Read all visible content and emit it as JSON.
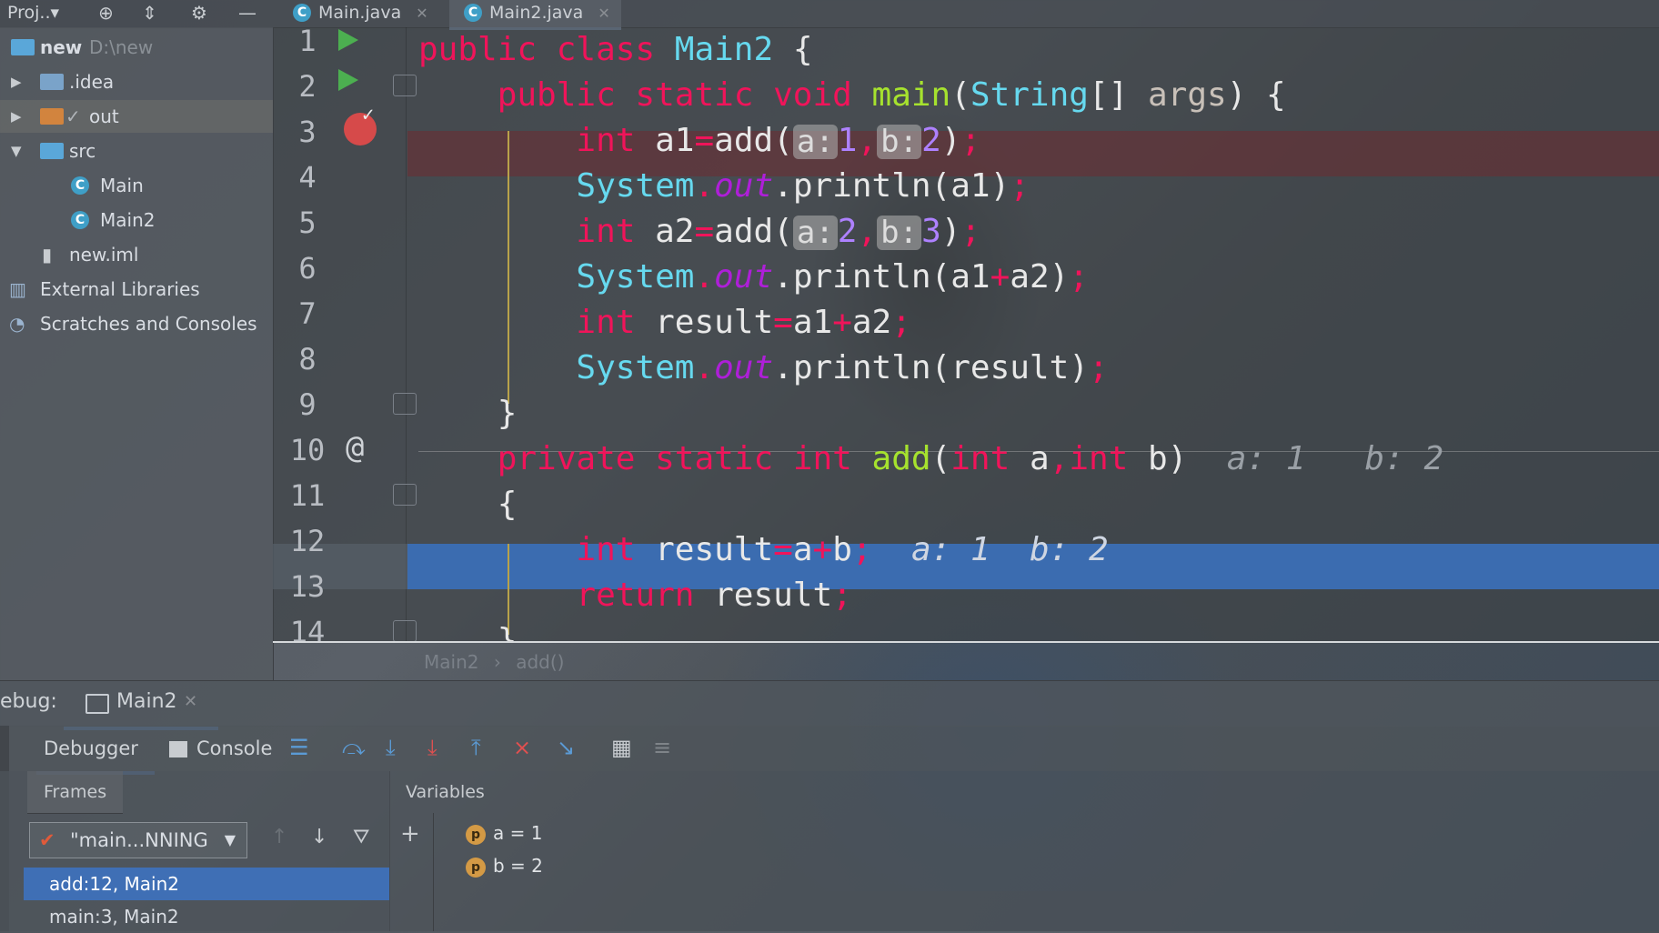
{
  "topbar": {
    "project_label": "Proj..▾",
    "tabs": [
      {
        "label": "Main.java",
        "active": false
      },
      {
        "label": "Main2.java",
        "active": true
      }
    ]
  },
  "project_tree": {
    "root": {
      "name": "new",
      "path": "D:\\new"
    },
    "items": [
      {
        "label": ".idea"
      },
      {
        "label": "out"
      },
      {
        "label": "src"
      },
      {
        "label": "Main"
      },
      {
        "label": "Main2"
      },
      {
        "label": "new.iml"
      },
      {
        "label": "External Libraries"
      },
      {
        "label": "Scratches and Consoles"
      }
    ]
  },
  "editor": {
    "line_numbers": [
      "1",
      "2",
      "3",
      "4",
      "5",
      "6",
      "7",
      "8",
      "9",
      "10",
      "11",
      "12",
      "13",
      "14"
    ],
    "inline_hints": {
      "line10": "a: 1   b: 2",
      "line12": "a: 1  b: 2"
    },
    "breadcrumb": [
      "Main2",
      "add()"
    ]
  },
  "debug": {
    "title": "ebug:",
    "session_tab": "Main2",
    "tabs": [
      "Debugger",
      "Console"
    ],
    "frames_label": "Frames",
    "variables_label": "Variables",
    "thread": "\"main...NNING",
    "frames": [
      "add:12, Main2",
      "main:3, Main2"
    ],
    "variables": [
      "a = 1",
      "b = 2"
    ]
  },
  "colors": {
    "keyword": "#f0145a",
    "function": "#a6e22e",
    "class": "#66d9ef",
    "execution_line": "#3b6cb0",
    "breakpoint_line": "#6e2c32"
  }
}
